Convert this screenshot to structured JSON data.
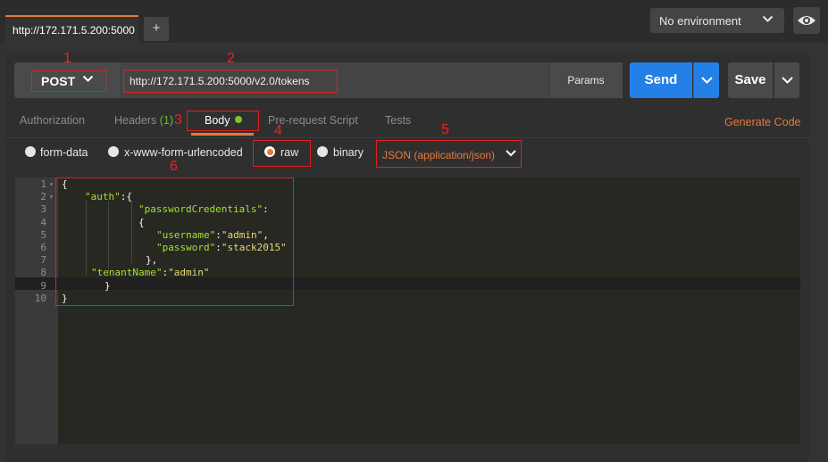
{
  "tabs": {
    "request_tab_label": "http://172.171.5.200:5000",
    "add_label": "+"
  },
  "environment": {
    "selected": "No environment"
  },
  "request": {
    "method": "POST",
    "url": "http://172.171.5.200:5000/v2.0/tokens",
    "params_label": "Params",
    "send_label": "Send",
    "save_label": "Save"
  },
  "subtabs": {
    "authorization": "Authorization",
    "headers": "Headers",
    "headers_count": "(1)",
    "body": "Body",
    "pre_request": "Pre-request Script",
    "tests": "Tests",
    "generate_code": "Generate Code"
  },
  "body_modes": {
    "form_data": "form-data",
    "urlencoded": "x-www-form-urlencoded",
    "raw": "raw",
    "binary": "binary",
    "selected": "raw",
    "content_type": "JSON (application/json)"
  },
  "editor": {
    "line_numbers": [
      "1",
      "2",
      "3",
      "4",
      "5",
      "6",
      "7",
      "8",
      "9",
      "10"
    ],
    "lines": [
      [
        {
          "t": "p",
          "v": "{"
        }
      ],
      [
        {
          "t": "k",
          "v": "\"auth\""
        },
        {
          "t": "p",
          "v": ":{"
        }
      ],
      [
        {
          "t": "k",
          "v": "\"passwordCredentials\""
        },
        {
          "t": "p",
          "v": ":"
        }
      ],
      [
        {
          "t": "p",
          "v": "{"
        }
      ],
      [
        {
          "t": "k",
          "v": "\"username\""
        },
        {
          "t": "p",
          "v": ":"
        },
        {
          "t": "s",
          "v": "\"admin\""
        },
        {
          "t": "p",
          "v": ","
        }
      ],
      [
        {
          "t": "k",
          "v": "\"password\""
        },
        {
          "t": "p",
          "v": ":"
        },
        {
          "t": "s",
          "v": "\"stack2015\""
        }
      ],
      [
        {
          "t": "p",
          "v": "},"
        }
      ],
      [
        {
          "t": "k",
          "v": "\"tenantName\""
        },
        {
          "t": "p",
          "v": ":"
        },
        {
          "t": "s",
          "v": "\"admin\""
        }
      ],
      [
        {
          "t": "p",
          "v": "}"
        }
      ],
      [
        {
          "t": "p",
          "v": "}"
        }
      ]
    ]
  },
  "annotations": [
    "1",
    "2",
    "3",
    "4",
    "5",
    "6"
  ],
  "colors": {
    "accent": "#e8793a",
    "send": "#2480e6",
    "annotation": "#e02020",
    "json_key": "#a6e22e",
    "json_string": "#e6db74"
  }
}
